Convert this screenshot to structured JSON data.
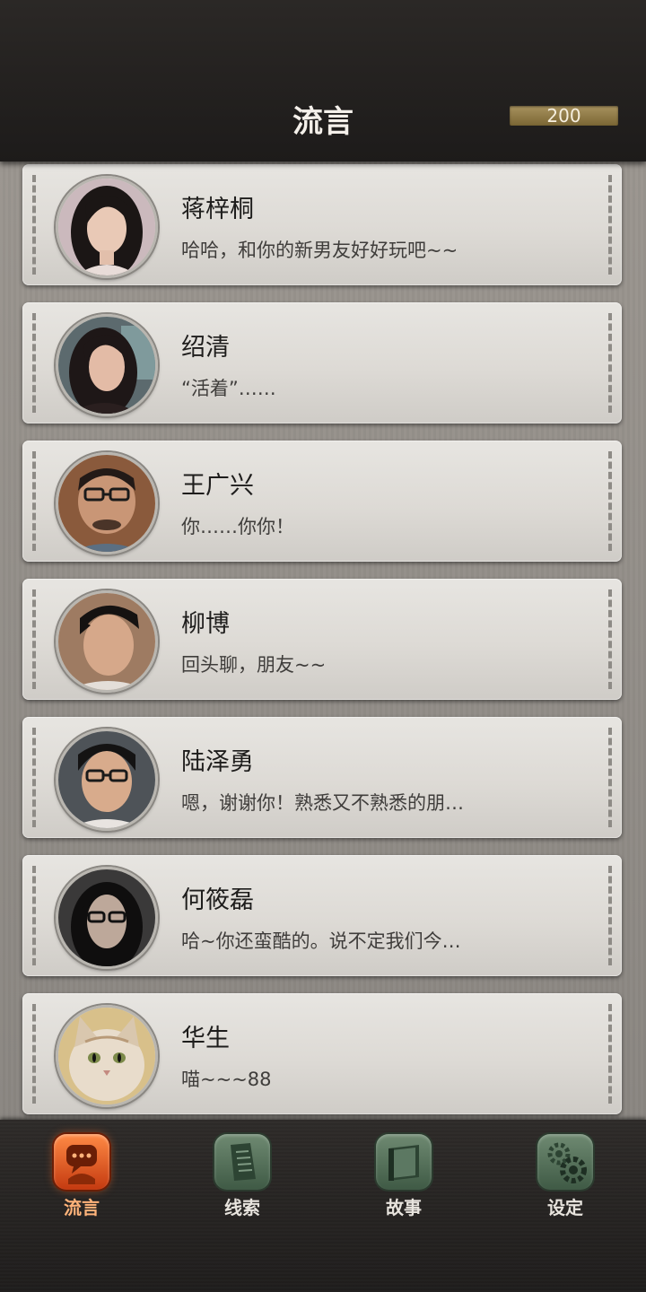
{
  "header": {
    "title": "流言",
    "coins": "200"
  },
  "contacts": [
    {
      "name": "蒋梓桐",
      "message": "哈哈，和你的新男友好好玩吧~~",
      "avatar_icon": "woman-portrait-avatar"
    },
    {
      "name": "绍清",
      "message": "“活着”……",
      "avatar_icon": "woman-portrait-avatar"
    },
    {
      "name": "王广兴",
      "message": "你……你你！",
      "avatar_icon": "man-glasses-portrait-avatar"
    },
    {
      "name": "柳博",
      "message": "回头聊，朋友~~",
      "avatar_icon": "man-portrait-avatar"
    },
    {
      "name": "陆泽勇",
      "message": "嗯，谢谢你！熟悉又不熟悉的朋…",
      "avatar_icon": "man-glasses-portrait-avatar"
    },
    {
      "name": "何筱磊",
      "message": "哈~你还蛮酷的。说不定我们今…",
      "avatar_icon": "man-longhair-glasses-avatar"
    },
    {
      "name": "华生",
      "message": "喵~~~88",
      "avatar_icon": "cat-portrait-avatar"
    }
  ],
  "tabs": [
    {
      "label": "流言",
      "icon": "chat-bubble-icon",
      "active": true
    },
    {
      "label": "线索",
      "icon": "document-icon",
      "active": false
    },
    {
      "label": "故事",
      "icon": "book-icon",
      "active": false
    },
    {
      "label": "设定",
      "icon": "gears-icon",
      "active": false
    }
  ],
  "colors": {
    "active_tab": "#e8561c",
    "inactive_tab": "#4f6b55",
    "coin_bar": "#8f7a46"
  }
}
